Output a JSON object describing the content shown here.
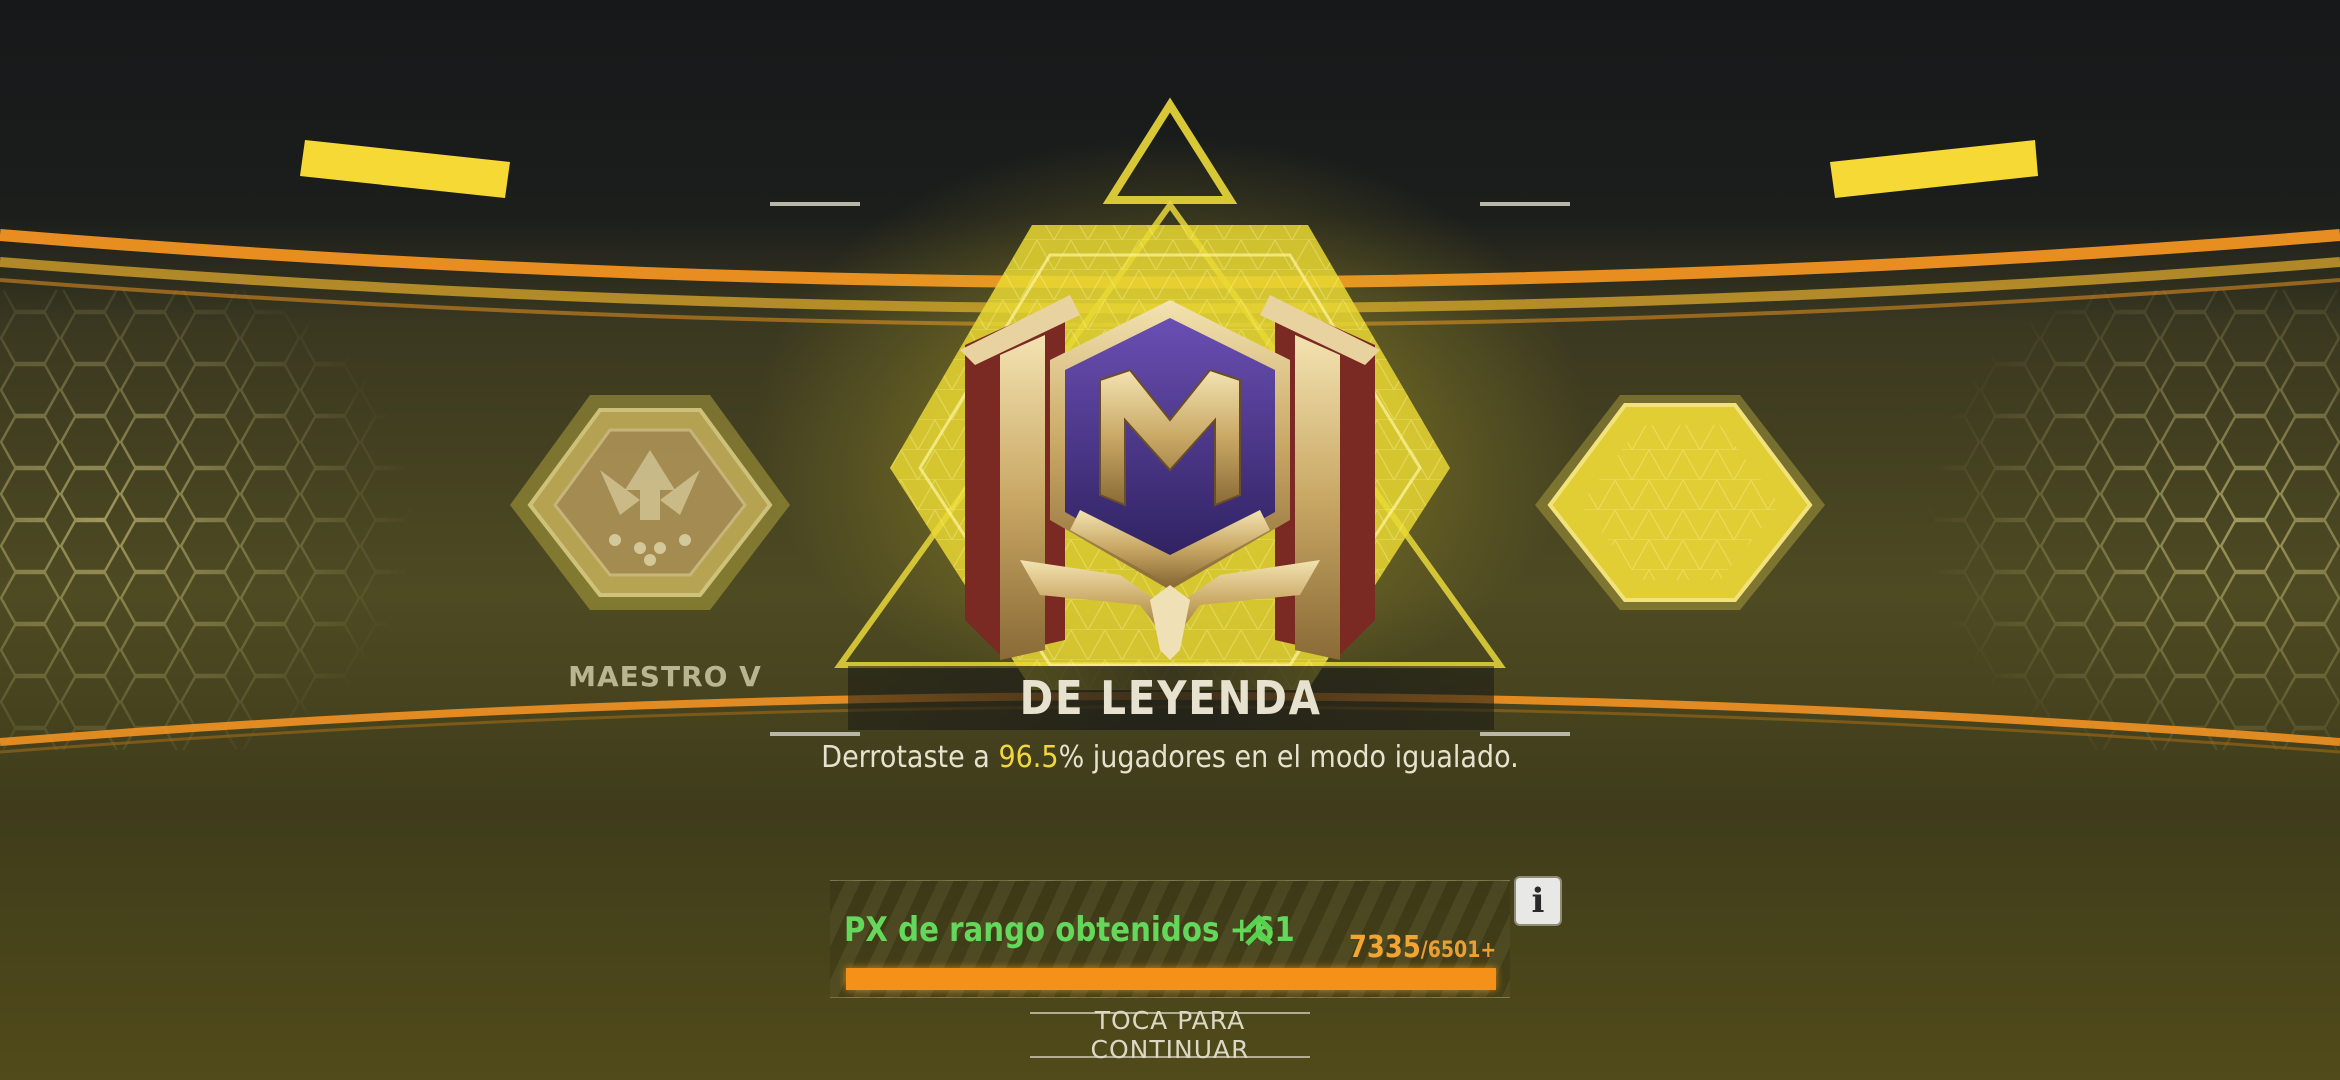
{
  "previous_rank": {
    "label": "MAESTRO V"
  },
  "current_rank": {
    "title": "DE LEYENDA"
  },
  "result": {
    "prefix": "Derrotaste a ",
    "percent": "96.5",
    "suffix": "% jugadores en el modo igualado."
  },
  "rank_xp": {
    "label": "PX de rango obtenidos +61",
    "current": "7335",
    "separator": "/",
    "max": "6501+",
    "fill_fraction": 1.0
  },
  "info_button": {
    "label": "i"
  },
  "continue_prompt": {
    "label": "TOCA PARA CONTINUAR"
  },
  "colors": {
    "accent_yellow": "#f2d640",
    "xp_green": "#63d85a",
    "xp_orange": "#f59118"
  },
  "icons": {
    "emblem": "legendary-rank-emblem-icon",
    "previous_emblem": "master-rank-emblem-icon",
    "next_slot": "hexagon-slot-icon",
    "xp_up": "double-chevron-up-icon"
  }
}
